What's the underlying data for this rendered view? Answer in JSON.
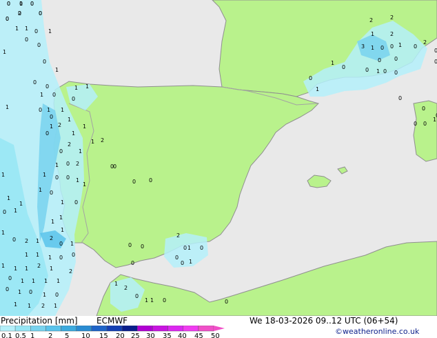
{
  "title": "Precipitation [mm]",
  "model": "ECMWF",
  "valid_time": "We 18-03-2026 09..12 UTC (06+54)",
  "credit": "©weatheronline.co.uk",
  "colors": {
    "sea": "#e9e9e9",
    "land": "#b9f28c",
    "coast": "#8f8f8f",
    "border": "#a3a3a3"
  },
  "scale": {
    "ticks": [
      "0.1",
      "0.5",
      "1",
      "2",
      "5",
      "10",
      "15",
      "20",
      "25",
      "30",
      "35",
      "40",
      "45",
      "50"
    ],
    "colors": [
      "#b4f0fa",
      "#96e6f5",
      "#78d2ee",
      "#5ac3eb",
      "#3caade",
      "#2a8cd2",
      "#1e64c8",
      "#1440b4",
      "#0a1e8c",
      "#b000d2",
      "#c814e0",
      "#dc28f0",
      "#f03cf0",
      "#f050c8"
    ]
  },
  "precip_labels": [
    "0",
    "0",
    "0",
    "2",
    "0",
    "0",
    "1",
    "1",
    "0",
    "1",
    "0",
    "0",
    "1",
    "0",
    "1",
    "0",
    "0",
    "1",
    "0",
    "1",
    "1",
    "0",
    "1",
    "1",
    "0",
    "2",
    "1",
    "1",
    "1",
    "0",
    "1",
    "1",
    "2",
    "2",
    "0",
    "1",
    "0",
    "1",
    "2",
    "0",
    "1",
    "1",
    "0",
    "0",
    "1",
    "1",
    "0",
    "1",
    "1",
    "0",
    "1",
    "1",
    "0",
    "1",
    "1",
    "1",
    "1",
    "1",
    "0",
    "2",
    "1",
    "2",
    "0",
    "1",
    "1",
    "1",
    "1",
    "0",
    "0",
    "1",
    "1",
    "1",
    "2",
    "1",
    "2",
    "0",
    "1",
    "1",
    "1",
    "1",
    "0",
    "1",
    "0",
    "1",
    "0",
    "1",
    "1",
    "2",
    "1",
    "2",
    "0",
    "1",
    "0",
    "0",
    "0",
    "1",
    "0",
    "0",
    "0",
    "0",
    "0",
    "0",
    "1",
    "0",
    "1",
    "2",
    "0",
    "1",
    "1",
    "0",
    "0",
    "2",
    "2",
    "1",
    "2",
    "3",
    "1",
    "0",
    "0",
    "1",
    "0",
    "2",
    "0",
    "0",
    "0",
    "0",
    "0",
    "1",
    "0",
    "0",
    "1",
    "0",
    "1",
    "0",
    "0",
    "1",
    "0",
    "0",
    "0",
    "0",
    "0",
    "1",
    "0",
    "0",
    "0",
    "0"
  ]
}
